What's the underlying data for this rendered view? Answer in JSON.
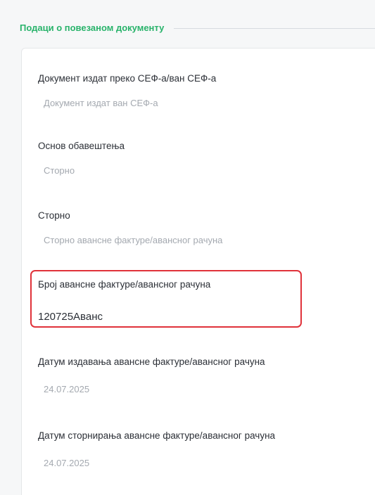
{
  "section": {
    "title": "Подаци о повезаном документу"
  },
  "fields": [
    {
      "label": "Документ издат преко СЕФ-а/ван СЕФ-а",
      "value": "Документ издат ван СЕФ-а"
    },
    {
      "label": "Основ обавештења",
      "value": "Сторно"
    },
    {
      "label": "Сторно",
      "value": "Сторно авансне фактуре/авансног рачуна"
    },
    {
      "label": "Број авансне фактуре/авансног рачуна",
      "value": "120725Аванс"
    },
    {
      "label": "Датум издавања авансне фактуре/авансног рачуна",
      "value": "24.07.2025"
    },
    {
      "label": "Датум сторнирања авансне фактуре/авансног рачуна",
      "value": "24.07.2025"
    }
  ]
}
